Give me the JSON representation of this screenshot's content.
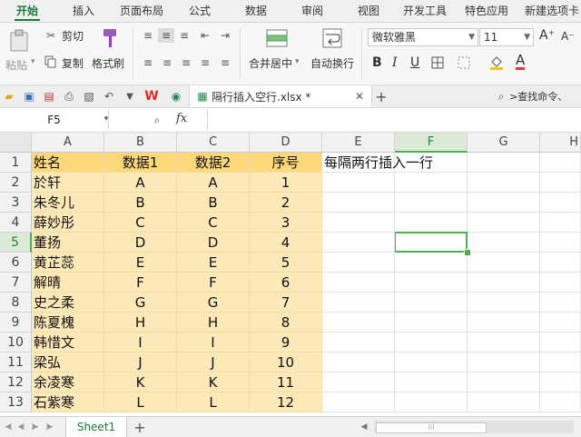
{
  "ribbon_tabs": [
    "开始",
    "插入",
    "页面布局",
    "公式",
    "数据",
    "审阅",
    "视图",
    "开发工具",
    "特色应用",
    "新建选项卡"
  ],
  "ribbon": {
    "paste": "粘贴",
    "cut": "剪切",
    "copy": "复制",
    "format_painter": "格式刷",
    "merge_center": "合并居中",
    "wrap_text": "自动换行",
    "font_name": "微软雅黑",
    "font_size": "11",
    "bold": "B",
    "italic": "I",
    "underline": "U",
    "font_color_letter": "A",
    "grow_font": "A⁺",
    "shrink_font": "A⁻"
  },
  "quickbar": {
    "doc_title": "隔行插入空行.xlsx *",
    "search": ">查找命令、"
  },
  "formula_bar": {
    "cell_ref": "F5",
    "fx": "fx",
    "value": ""
  },
  "sheet": {
    "columns": [
      "A",
      "B",
      "C",
      "D",
      "E",
      "F",
      "G",
      "H"
    ],
    "selected_column": "F",
    "selected_row": "5",
    "rows": [
      {
        "n": "1",
        "a": "姓名",
        "b": "数据1",
        "c": "数据2",
        "d": "序号",
        "e": "每隔两行插入一行"
      },
      {
        "n": "2",
        "a": "於轩",
        "b": "A",
        "c": "A",
        "d": "1",
        "e": ""
      },
      {
        "n": "3",
        "a": "朱冬儿",
        "b": "B",
        "c": "B",
        "d": "2",
        "e": ""
      },
      {
        "n": "4",
        "a": "薛妙彤",
        "b": "C",
        "c": "C",
        "d": "3",
        "e": ""
      },
      {
        "n": "5",
        "a": "董扬",
        "b": "D",
        "c": "D",
        "d": "4",
        "e": ""
      },
      {
        "n": "6",
        "a": "黄芷蕊",
        "b": "E",
        "c": "E",
        "d": "5",
        "e": ""
      },
      {
        "n": "7",
        "a": "解晴",
        "b": "F",
        "c": "F",
        "d": "6",
        "e": ""
      },
      {
        "n": "8",
        "a": "史之柔",
        "b": "G",
        "c": "G",
        "d": "7",
        "e": ""
      },
      {
        "n": "9",
        "a": "陈夏槐",
        "b": "H",
        "c": "H",
        "d": "8",
        "e": ""
      },
      {
        "n": "10",
        "a": "韩惜文",
        "b": "I",
        "c": "I",
        "d": "9",
        "e": ""
      },
      {
        "n": "11",
        "a": "梁弘",
        "b": "J",
        "c": "J",
        "d": "10",
        "e": ""
      },
      {
        "n": "12",
        "a": "余凌寒",
        "b": "K",
        "c": "K",
        "d": "11",
        "e": ""
      },
      {
        "n": "13",
        "a": "石紫寒",
        "b": "L",
        "c": "L",
        "d": "12",
        "e": ""
      }
    ]
  },
  "sheet_tabs": [
    "Sheet1"
  ],
  "colors": {
    "accent_green": "#1a7a3b",
    "header_fill": "#fdd87a",
    "data_fill": "#fde9b8",
    "selection_border": "#4caf50"
  }
}
